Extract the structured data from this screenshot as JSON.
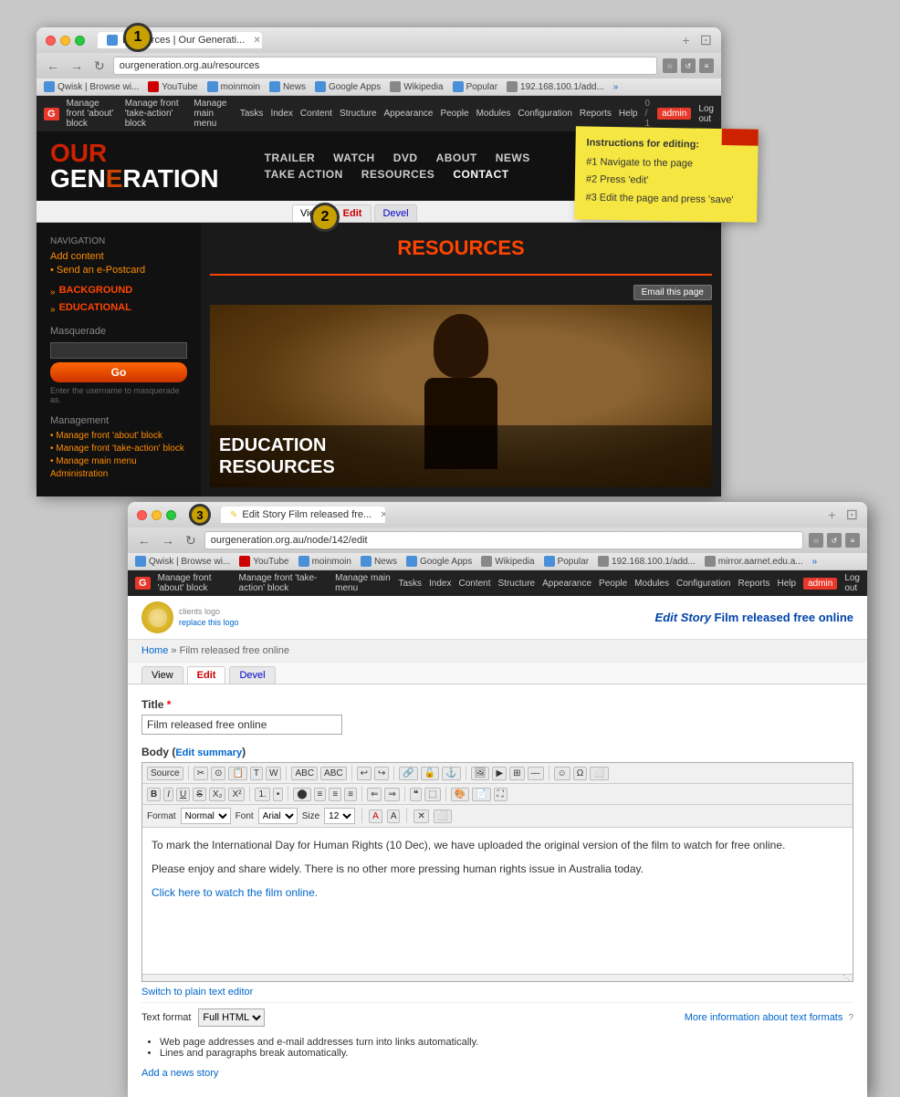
{
  "window1": {
    "tab_title": "Resources | Our Generati...",
    "url": "ourgeneration.org.au/resources",
    "bookmarks": [
      {
        "label": "Qwisk | Browse wi...",
        "color": "#4a90d9"
      },
      {
        "label": "YouTube",
        "color": "#cc0000"
      },
      {
        "label": "moinmoin",
        "color": "#4a90d9"
      },
      {
        "label": "News",
        "color": "#4a90d9"
      },
      {
        "label": "Google Apps",
        "color": "#4a90d9"
      },
      {
        "label": "Wikipedia",
        "color": "#888"
      },
      {
        "label": "Popular",
        "color": "#4a90d9"
      },
      {
        "label": "192.168.100.1/add...",
        "color": "#888"
      }
    ],
    "admin_links": [
      "Manage front 'about' block",
      "Manage front 'take-action' block",
      "Manage main menu",
      "Tasks",
      "Index",
      "Content",
      "Structure",
      "Appearance",
      "People",
      "Modules",
      "Configuration",
      "Reports",
      "Help"
    ],
    "user_count": "0 / 1",
    "admin_label": "admin",
    "logout_label": "Log out",
    "site_name": "OUR GENERATION",
    "nav_items": [
      {
        "label": "TRAILER"
      },
      {
        "label": "WATCH"
      },
      {
        "label": "DVD"
      },
      {
        "label": "ABOUT"
      },
      {
        "label": "NEWS"
      },
      {
        "label": "TAKE ACTION"
      },
      {
        "label": "RESOURCES"
      },
      {
        "label": "CONTACT"
      }
    ],
    "sidebar": {
      "nav_label": "Navigation",
      "add_content": "Add content",
      "send_postcard": "Send an e-Postcard",
      "section1_label": "BACKGROUND",
      "section2_label": "EDUCATIONAL",
      "masquerade_label": "Masquerade",
      "masquerade_btn": "Go",
      "masquerade_note": "Enter the username to masquerade as.",
      "management_label": "Management",
      "manage_links": [
        "Manage front 'about' block",
        "Manage front 'take-action' block",
        "Manage main menu",
        "Administration"
      ]
    },
    "tabs": {
      "view": "View",
      "edit": "Edit",
      "devel": "Devel"
    },
    "page_title": "RESOURCES",
    "email_btn": "Email this page",
    "image_overlay": {
      "line1": "EDUCATION",
      "line2": "RESOURCES"
    },
    "step1_number": "1",
    "step2_number": "2"
  },
  "sticky_note": {
    "title": "Instructions for editing:",
    "step1": "#1 Navigate to the page",
    "step2": "#2 Press 'edit'",
    "step3": "#3 Edit the page and press 'save'"
  },
  "window2": {
    "tab_title": "Edit Story Film released fre...",
    "url": "ourgeneration.org.au/node/142/edit",
    "admin_links": [
      "Manage front 'about' block",
      "Manage front 'take-action' block",
      "Manage main menu",
      "Tasks",
      "Index",
      "Content",
      "Structure",
      "Appearance",
      "People",
      "Modules",
      "Configuration",
      "Reports",
      "Help"
    ],
    "user_count": "0 / 1",
    "admin_label": "admin",
    "logout_label": "Log out",
    "client_logo_text1": "clients logo",
    "client_logo_text2": "replace this logo",
    "breadcrumb_home": "Home",
    "breadcrumb_sep": "»",
    "breadcrumb_page": "Film released free online",
    "edit_title_prefix": "Edit Story ",
    "edit_title_main": "Film released free online",
    "tabs": {
      "view": "View",
      "edit": "Edit",
      "devel": "Devel"
    },
    "form": {
      "title_label": "Title",
      "title_required": "*",
      "title_value": "Film released free online",
      "body_label": "Body",
      "edit_summary": "Edit summary",
      "toolbar_btns": [
        "Source",
        "←",
        "→",
        "✂",
        "⧉",
        "⧉",
        "✗",
        "abc",
        "abc",
        "▷",
        "◁",
        "◁",
        "✓",
        "✎",
        "⊕",
        "⊖",
        "⊕",
        "▣",
        "○",
        "⊗",
        "≡",
        "≡",
        "≡"
      ],
      "format_btns": [
        "B",
        "I",
        "U",
        "abc",
        "X₂",
        "X²"
      ],
      "format_label": "Format",
      "font_label": "Font",
      "size_label": "Size",
      "content_para1": "To mark the International Day for Human Rights (10 Dec), we have uploaded the original version of the film to watch for free online.",
      "content_para2": "Please enjoy and share widely. There is no other more pressing human rights issue in Australia today.",
      "content_link": "Click here to watch the film online.",
      "switch_link": "Switch to plain text editor",
      "text_format_label": "Text format",
      "text_format_value": "Full HTML",
      "format_note1": "Web page addresses and e-mail addresses turn into links automatically.",
      "format_note2": "Lines and paragraphs break automatically.",
      "more_formats_link": "More information about text formats",
      "add_news_link": "Add a news story"
    },
    "step3_number": "3"
  }
}
